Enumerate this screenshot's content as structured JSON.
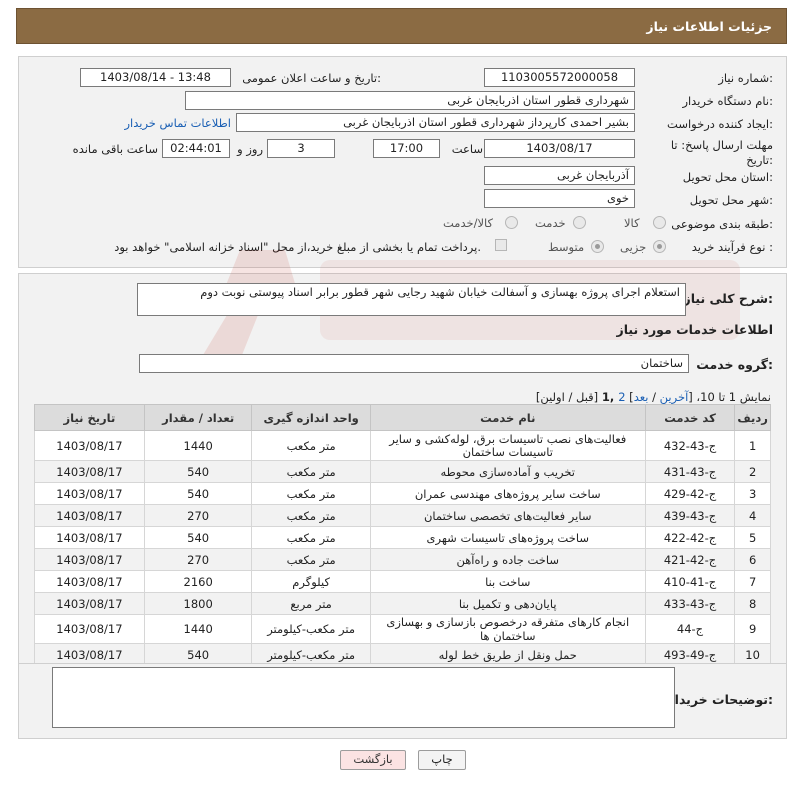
{
  "header": {
    "title": "جزئیات اطلاعات نیاز"
  },
  "form": {
    "need_number_label": "شماره نیاز:",
    "need_number": "1103005572000058",
    "announce_label": "تاریخ و ساعت اعلان عمومی:",
    "announce_value": "1403/08/14 - 13:48",
    "buyer_org_label": "نام دستگاه خریدار:",
    "buyer_org": "شهرداری قطور استان اذربایجان غربی",
    "requester_label": "ایجاد کننده درخواست:",
    "requester": "بشیر احمدی کارپرداز شهرداری قطور استان اذربایجان غربی",
    "contact_link": "اطلاعات تماس خریدار",
    "deadline_label": "مهلت ارسال پاسخ: تا تاریخ:",
    "deadline_date": "1403/08/17",
    "time_label": "ساعت",
    "deadline_time": "17:00",
    "days_value": "3",
    "days_label": "روز و",
    "remaining_time": "02:44:01",
    "remaining_label": "ساعت باقی مانده",
    "province_label": "استان محل تحویل:",
    "province": "آذربایجان غربی",
    "city_label": "شهر محل تحویل:",
    "city": "خوی",
    "category_label": "طبقه بندی موضوعی:",
    "category_options": [
      "کالا",
      "خدمت",
      "کالا/خدمت"
    ],
    "process_label": "نوع فرآیند خرید :",
    "process_options": [
      "جزیی",
      "متوسط"
    ],
    "payment_note": "پرداخت تمام یا بخشی از مبلغ خرید،از محل \"اسناد خزانه اسلامی\" خواهد بود."
  },
  "summary": {
    "label": "شرح کلی نیاز:",
    "text": "استعلام اجرای پروژه بهسازی و آسفالت خیابان شهید رجایی شهر قطور برابر اسناد پیوستی نوبت دوم"
  },
  "services": {
    "section_title": "اطلاعات خدمات مورد نیاز",
    "group_label": "گروه خدمت:",
    "group_value": "ساختمان",
    "pagination": {
      "prefix": "نمایش 1 تا 10، [",
      "last": "آخرین",
      "sep1": " / ",
      "next": "بعد",
      "close": "] ",
      "page2": "2",
      "page1": " ,1",
      "tail": " [قبل / اولین]"
    },
    "columns": [
      "ردیف",
      "کد خدمت",
      "نام خدمت",
      "واحد اندازه گیری",
      "تعداد / مقدار",
      "تاریخ نیاز"
    ],
    "rows": [
      [
        "1",
        "ج-43-432",
        "فعالیت‌های نصب تاسیسات برق، لوله‌کشی و سایر تاسیسات ساختمان",
        "متر مکعب",
        "1440",
        "1403/08/17"
      ],
      [
        "2",
        "ج-43-431",
        "تخریب و آماده‌سازی محوطه",
        "متر مکعب",
        "540",
        "1403/08/17"
      ],
      [
        "3",
        "ج-42-429",
        "ساخت سایر پروژه‌های مهندسی عمران",
        "متر مکعب",
        "540",
        "1403/08/17"
      ],
      [
        "4",
        "ج-43-439",
        "سایر فعالیت‌های تخصصی ساختمان",
        "متر مکعب",
        "270",
        "1403/08/17"
      ],
      [
        "5",
        "ج-42-422",
        "ساخت پروژه‌های تاسیسات شهری",
        "متر مکعب",
        "540",
        "1403/08/17"
      ],
      [
        "6",
        "ج-42-421",
        "ساخت جاده و راه‌آهن",
        "متر مکعب",
        "270",
        "1403/08/17"
      ],
      [
        "7",
        "ج-41-410",
        "ساخت بنا",
        "کیلوگرم",
        "2160",
        "1403/08/17"
      ],
      [
        "8",
        "ج-43-433",
        "پایان‌دهی و تکمیل بنا",
        "متر مربع",
        "1800",
        "1403/08/17"
      ],
      [
        "9",
        "ج-44",
        "انجام کارهای متفرقه درخصوص بازسازی و بهسازی ساختمان ها",
        "متر مکعب-کیلومتر",
        "1440",
        "1403/08/17"
      ],
      [
        "10",
        "ج-49-493",
        "حمل ونقل از طریق خط لوله",
        "متر مکعب-کیلومتر",
        "540",
        "1403/08/17"
      ]
    ]
  },
  "buyer_notes": {
    "label": "توضیحات خریدار:",
    "value": ""
  },
  "buttons": {
    "print": "چاپ",
    "back": "بازگشت"
  },
  "colors": {
    "header_bg": "#8b6b43",
    "link": "#1a5fb4",
    "back_button_bg": "#fbe3e3"
  }
}
